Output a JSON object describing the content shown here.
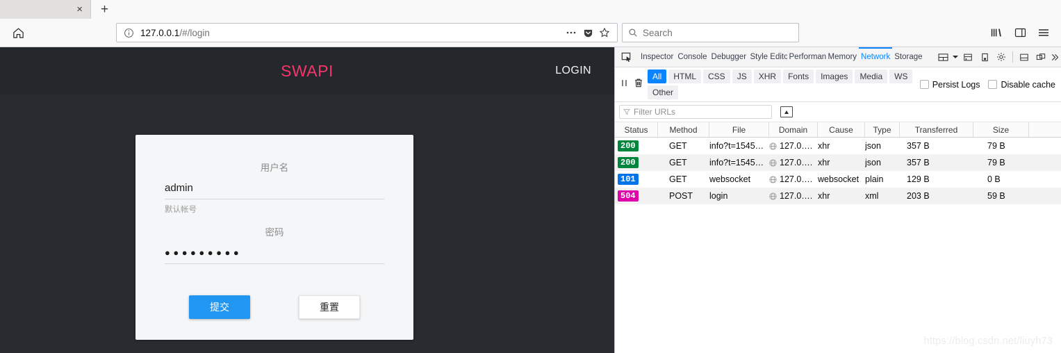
{
  "browser": {
    "tab": {
      "close_label": "×",
      "newtab_label": "+"
    },
    "nav": {
      "home_icon": "home-icon",
      "identity_icon": "info-circle-icon",
      "url_host": "127.0.0.1",
      "url_path": "/#/login",
      "page_actions_icon": "ellipsis-icon",
      "pocket_icon": "pocket-icon",
      "bookmark_icon": "star-icon",
      "library_icon": "library-icon",
      "sidebar_icon": "sidebar-icon",
      "menu_icon": "hamburger-menu-icon"
    },
    "search": {
      "placeholder": "Search",
      "icon": "search-icon"
    }
  },
  "page": {
    "brand": "SWAPI",
    "login_link": "LOGIN",
    "brand_color": "#f5356c",
    "header_bg": "#24272c",
    "body_bg": "#282c31",
    "form": {
      "username_label": "用户名",
      "username_value": "admin",
      "username_hint": "默认帐号",
      "password_label": "密码",
      "password_value": "●●●●●●●●●",
      "submit_label": "提交",
      "reset_label": "重置",
      "submit_color": "#2196f3"
    }
  },
  "devtools": {
    "picker_icon": "element-picker-icon",
    "tabs": [
      {
        "label": "Inspector",
        "active": false
      },
      {
        "label": "Console",
        "active": false
      },
      {
        "label": "Debugger",
        "active": false
      },
      {
        "label": "Style Editor",
        "active": false
      },
      {
        "label": "Performance",
        "active": false
      },
      {
        "label": "Memory",
        "active": false
      },
      {
        "label": "Network",
        "active": true
      },
      {
        "label": "Storage",
        "active": false
      }
    ],
    "active_tab_color": "#0a84ff",
    "tool_icons": [
      "split-layout-icon",
      "chevron-down-icon",
      "split-console-icon",
      "responsive-mode-icon",
      "settings-gear-icon",
      "dock-bottom-icon",
      "dock-separate-window-icon",
      "close-devtools-icon"
    ],
    "controls": {
      "pause_icon": "pause-icon",
      "clear_icon": "trash-icon"
    },
    "filters": [
      {
        "label": "All",
        "active": true
      },
      {
        "label": "HTML",
        "active": false
      },
      {
        "label": "CSS",
        "active": false
      },
      {
        "label": "JS",
        "active": false
      },
      {
        "label": "XHR",
        "active": false
      },
      {
        "label": "Fonts",
        "active": false
      },
      {
        "label": "Images",
        "active": false
      },
      {
        "label": "Media",
        "active": false
      },
      {
        "label": "WS",
        "active": false
      },
      {
        "label": "Other",
        "active": false
      }
    ],
    "checkboxes": [
      {
        "label": "Persist Logs",
        "checked": false
      },
      {
        "label": "Disable cache",
        "checked": false
      }
    ],
    "filter_urls": {
      "placeholder": "Filter URLs",
      "icon": "funnel-icon"
    },
    "har_button_icon": "har-import-export-icon",
    "table": {
      "columns": [
        "Status",
        "Method",
        "File",
        "Domain",
        "Cause",
        "Type",
        "Transferred",
        "Size"
      ],
      "rows": [
        {
          "status": "200",
          "status_color": "#00853e",
          "method": "GET",
          "file": "info?t=1545…",
          "domain": "127.0….",
          "cause": "xhr",
          "type": "json",
          "transferred": "357 B",
          "size": "79 B"
        },
        {
          "status": "200",
          "status_color": "#00853e",
          "method": "GET",
          "file": "info?t=1545…",
          "domain": "127.0….",
          "cause": "xhr",
          "type": "json",
          "transferred": "357 B",
          "size": "79 B"
        },
        {
          "status": "101",
          "status_color": "#0074e8",
          "method": "GET",
          "file": "websocket",
          "domain": "127.0….",
          "cause": "websocket",
          "type": "plain",
          "transferred": "129 B",
          "size": "0 B"
        },
        {
          "status": "504",
          "status_color": "#dd00a9",
          "method": "POST",
          "file": "login",
          "domain": "127.0….",
          "cause": "xhr",
          "type": "xml",
          "transferred": "203 B",
          "size": "59 B"
        }
      ]
    },
    "watermark": "https://blog.csdn.net/liuyh73"
  }
}
